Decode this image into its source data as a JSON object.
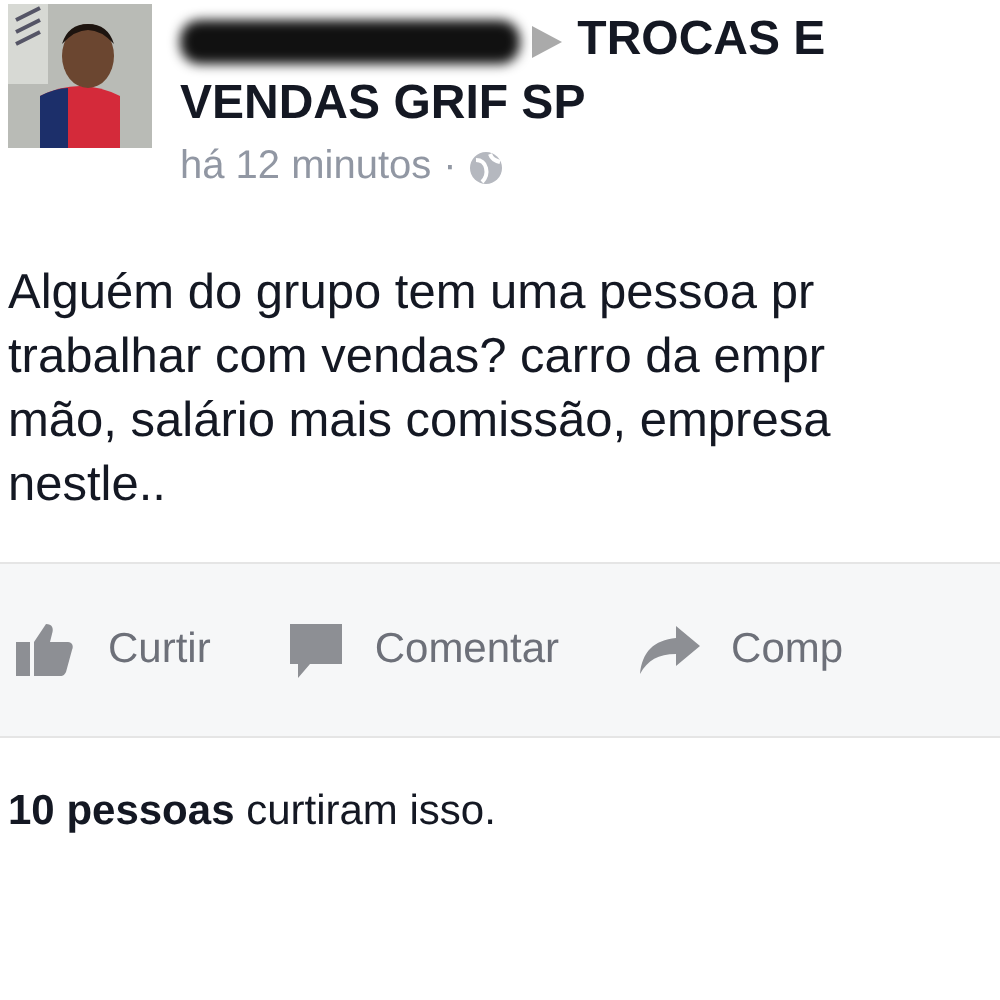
{
  "post": {
    "group_lines": [
      "TROCAS E",
      "VENDAS GRIF SP"
    ],
    "time": "há 12 minutos",
    "privacy_separator": "·",
    "lines": [
      "Alguém do grupo tem uma pessoa pr",
      "trabalhar com vendas? carro da empr",
      "mão, salário mais comissão, empresa",
      "nestle.."
    ]
  },
  "actions": [
    {
      "kind": "like",
      "label": "Curtir"
    },
    {
      "kind": "comment",
      "label": "Comentar"
    },
    {
      "kind": "share",
      "label": "Comp"
    }
  ],
  "likes": "**10 pessoas** curtiram isso."
}
